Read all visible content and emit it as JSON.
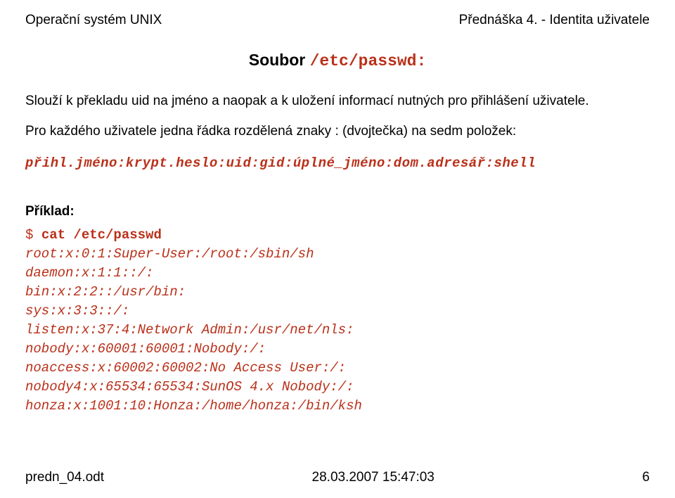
{
  "header": {
    "left": "Operační systém UNIX",
    "right": "Přednáška 4. - Identita uživatele"
  },
  "title": {
    "text": "Soubor ",
    "mono": "/etc/passwd:"
  },
  "para1": "Slouží k překladu uid na jméno a naopak a k uložení informací nutných pro přihlášení uživatele.",
  "para2": "Pro každého uživatele jedna řádka rozdělená znaky : (dvojtečka) na sedm položek:",
  "format_line": "přihl.jméno:krypt.heslo:uid:gid:úplné_jméno:dom.adresář:shell",
  "example_label": "Příklad:",
  "code": {
    "prompt": "$ ",
    "command": "cat /etc/passwd",
    "output": [
      "root:x:0:1:Super-User:/root:/sbin/sh",
      "daemon:x:1:1::/:",
      "bin:x:2:2::/usr/bin:",
      "sys:x:3:3::/:",
      "listen:x:37:4:Network Admin:/usr/net/nls:",
      "nobody:x:60001:60001:Nobody:/:",
      "noaccess:x:60002:60002:No Access User:/:",
      "nobody4:x:65534:65534:SunOS 4.x Nobody:/:",
      "honza:x:1001:10:Honza:/home/honza:/bin/ksh"
    ]
  },
  "footer": {
    "left": "predn_04.odt",
    "center": "28.03.2007 15:47:03",
    "right": "6"
  }
}
